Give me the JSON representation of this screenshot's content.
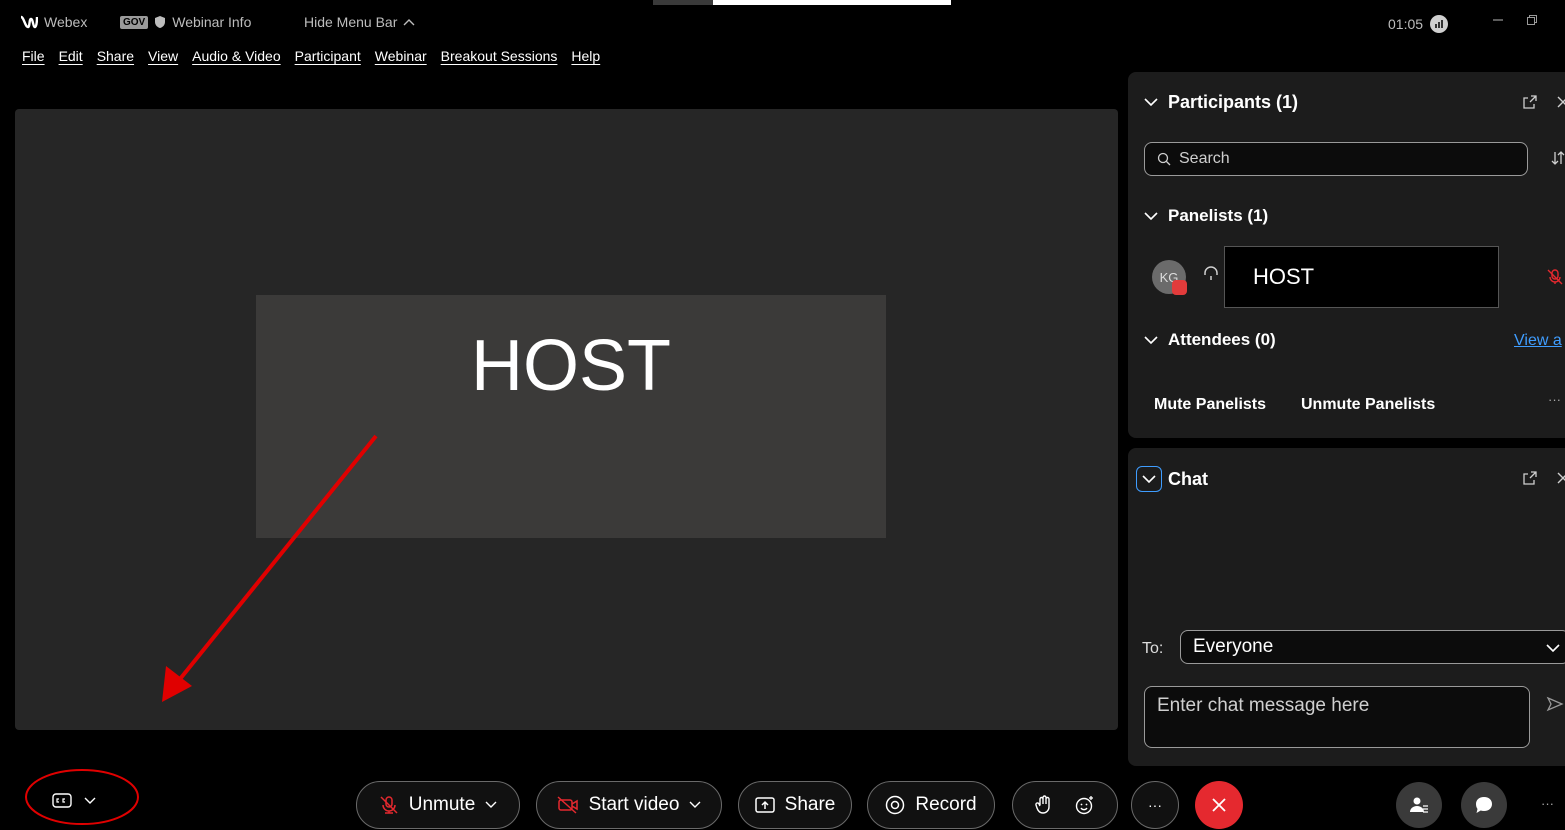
{
  "titlebar": {
    "app_name": "Webex",
    "gov_badge": "GOV",
    "webinar_info": "Webinar Info",
    "hide_menu_bar": "Hide Menu Bar",
    "time": "01:05"
  },
  "menubar": [
    "File",
    "Edit",
    "Share",
    "View",
    "Audio & Video",
    "Participant",
    "Webinar",
    "Breakout Sessions",
    "Help"
  ],
  "stage": {
    "host_tile_label": "HOST"
  },
  "participants_panel": {
    "title": "Participants (1)",
    "search_placeholder": "Search",
    "panelists_title": "Panelists (1)",
    "panelist_initials": "KG",
    "panelist_name": "HOST",
    "attendees_title": "Attendees (0)",
    "view_all_link": "View a",
    "mute_panelists": "Mute Panelists",
    "unmute_panelists": "Unmute Panelists",
    "more": "···"
  },
  "chat_panel": {
    "title": "Chat",
    "to_label": "To:",
    "to_value": "Everyone",
    "input_placeholder": "Enter chat message here"
  },
  "toolbar": {
    "unmute": "Unmute",
    "start_video": "Start video",
    "share": "Share",
    "record": "Record",
    "more": "···"
  },
  "colors": {
    "accent_red": "#e5292f",
    "annotation_red": "#e00000",
    "link_blue": "#3f9dff"
  }
}
